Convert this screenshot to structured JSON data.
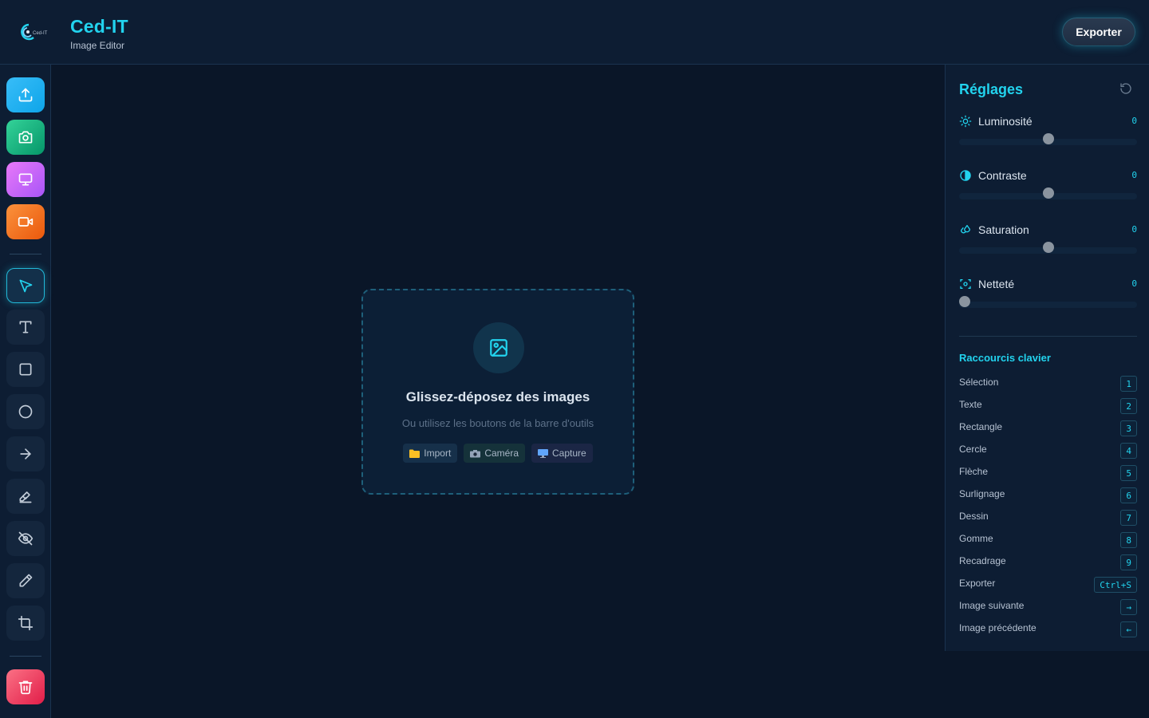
{
  "header": {
    "brand_title": "Ced-IT",
    "brand_subtitle": "Image Editor",
    "logo_text": "Ced-IT",
    "export_label": "Exporter"
  },
  "toolbar": {
    "actions": [
      {
        "name": "upload",
        "icon": "upload-icon"
      },
      {
        "name": "camera",
        "icon": "camera-icon"
      },
      {
        "name": "screen",
        "icon": "monitor-icon"
      },
      {
        "name": "video",
        "icon": "video-icon"
      }
    ],
    "tools": [
      {
        "name": "select",
        "icon": "cursor-icon",
        "active": true
      },
      {
        "name": "text",
        "icon": "text-icon"
      },
      {
        "name": "rectangle",
        "icon": "square-icon"
      },
      {
        "name": "circle",
        "icon": "circle-icon"
      },
      {
        "name": "arrow",
        "icon": "arrow-right-icon"
      },
      {
        "name": "highlight",
        "icon": "highlighter-icon"
      },
      {
        "name": "blur",
        "icon": "eye-off-icon"
      },
      {
        "name": "draw",
        "icon": "pencil-icon"
      },
      {
        "name": "crop",
        "icon": "crop-icon"
      }
    ],
    "delete": {
      "icon": "trash-icon"
    }
  },
  "dropzone": {
    "icon": "image-icon",
    "title": "Glissez-déposez des images",
    "subtitle": "Ou utilisez les boutons de la barre d'outils",
    "chips": {
      "import": {
        "label": "Import",
        "icon": "folder-icon"
      },
      "camera": {
        "label": "Caméra",
        "icon": "camera-icon"
      },
      "capture": {
        "label": "Capture",
        "icon": "monitor-icon"
      }
    }
  },
  "panel": {
    "title": "Réglages",
    "adjustments": {
      "brightness": {
        "label": "Luminosité",
        "value": "0",
        "level": 0.5,
        "icon": "sun-icon"
      },
      "contrast": {
        "label": "Contraste",
        "value": "0",
        "level": 0.5,
        "icon": "contrast-icon"
      },
      "saturation": {
        "label": "Saturation",
        "value": "0",
        "level": 0.5,
        "icon": "droplets-icon"
      },
      "sharpness": {
        "label": "Netteté",
        "value": "0",
        "level": 0.0,
        "icon": "focus-icon"
      }
    },
    "shortcuts_title": "Raccourcis clavier",
    "shortcuts": [
      {
        "name": "Sélection",
        "key": "1"
      },
      {
        "name": "Texte",
        "key": "2"
      },
      {
        "name": "Rectangle",
        "key": "3"
      },
      {
        "name": "Cercle",
        "key": "4"
      },
      {
        "name": "Flèche",
        "key": "5"
      },
      {
        "name": "Surlignage",
        "key": "6"
      },
      {
        "name": "Dessin",
        "key": "7"
      },
      {
        "name": "Gomme",
        "key": "8"
      },
      {
        "name": "Recadrage",
        "key": "9"
      },
      {
        "name": "Exporter",
        "key": "Ctrl+S"
      },
      {
        "name": "Image suivante",
        "key": "→"
      },
      {
        "name": "Image précédente",
        "key": "←"
      }
    ]
  },
  "colors": {
    "accent": "#22d3ee",
    "background": "#0a1628",
    "panel": "#0d1d33"
  }
}
